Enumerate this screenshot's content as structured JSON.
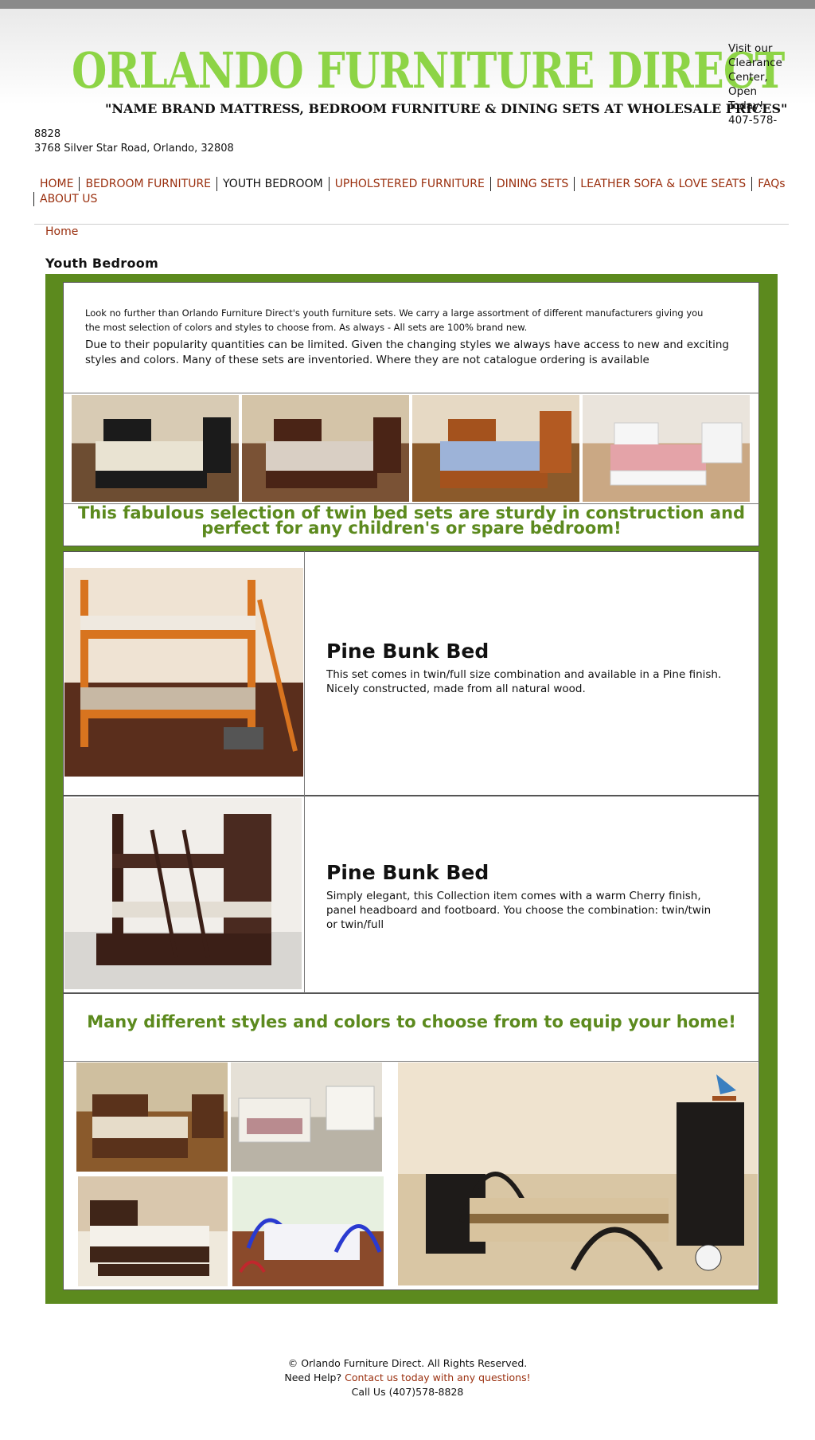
{
  "header": {
    "title": "ORLANDO FURNITURE DIRECT",
    "tagline": "\"NAME BRAND MATTRESS, BEDROOM FURNITURE & DINING SETS AT WHOLESALE PRICES\"",
    "visit_lines": [
      "Visit our",
      "Clearance",
      "Center,",
      "Open",
      "Today!",
      "407-578-"
    ],
    "address_lines": [
      "8828",
      "3768 Silver Star Road, Orlando, 32808"
    ]
  },
  "nav": {
    "items": [
      "HOME",
      "BEDROOM FURNITURE",
      "YOUTH BEDROOM",
      "UPHOLSTERED FURNITURE",
      "DINING SETS",
      "LEATHER SOFA & LOVE SEATS",
      "FAQs",
      "ABOUT US"
    ],
    "active": "YOUTH BEDROOM"
  },
  "breadcrumb": "Home",
  "page_title": "Youth Bedroom",
  "intro": {
    "p1": "Look no further than Orlando Furniture Direct's youth furniture sets. We carry a large assortment of different manufacturers giving you the most selection of colors and styles to choose from. As always - All sets are 100% brand new.",
    "p2": "Due to their popularity quantities can be limited. Given the changing styles we always have access to new and exciting styles and colors. Many of these sets are inventoried. Where they are not catalogue ordering is available"
  },
  "twin_caption": "This fabulous selection of twin bed sets are sturdy in construction and perfect for any children's or spare bedroom!",
  "products": [
    {
      "title": "Pine Bunk Bed",
      "desc": "This set comes in twin/full size combination and available in a Pine finish. Nicely constructed, made from all natural wood."
    },
    {
      "title": "Pine Bunk Bed",
      "desc": "Simply elegant, this Collection item comes with a warm Cherry finish, panel headboard and footboard. You choose the combination: twin/twin or twin/full"
    }
  ],
  "styles_caption": "Many different styles and colors to choose from to equip your home!",
  "footer": {
    "copyright": "© Orlando Furniture Direct. All Rights Reserved.",
    "help_label": "Need Help?",
    "help_link": "Contact us today with any questions!",
    "call": "Call Us (407)578-8828"
  },
  "colors": {
    "title_green": "#8dd446",
    "panel_green": "#5c8a1e",
    "link": "#9a2f0e"
  }
}
